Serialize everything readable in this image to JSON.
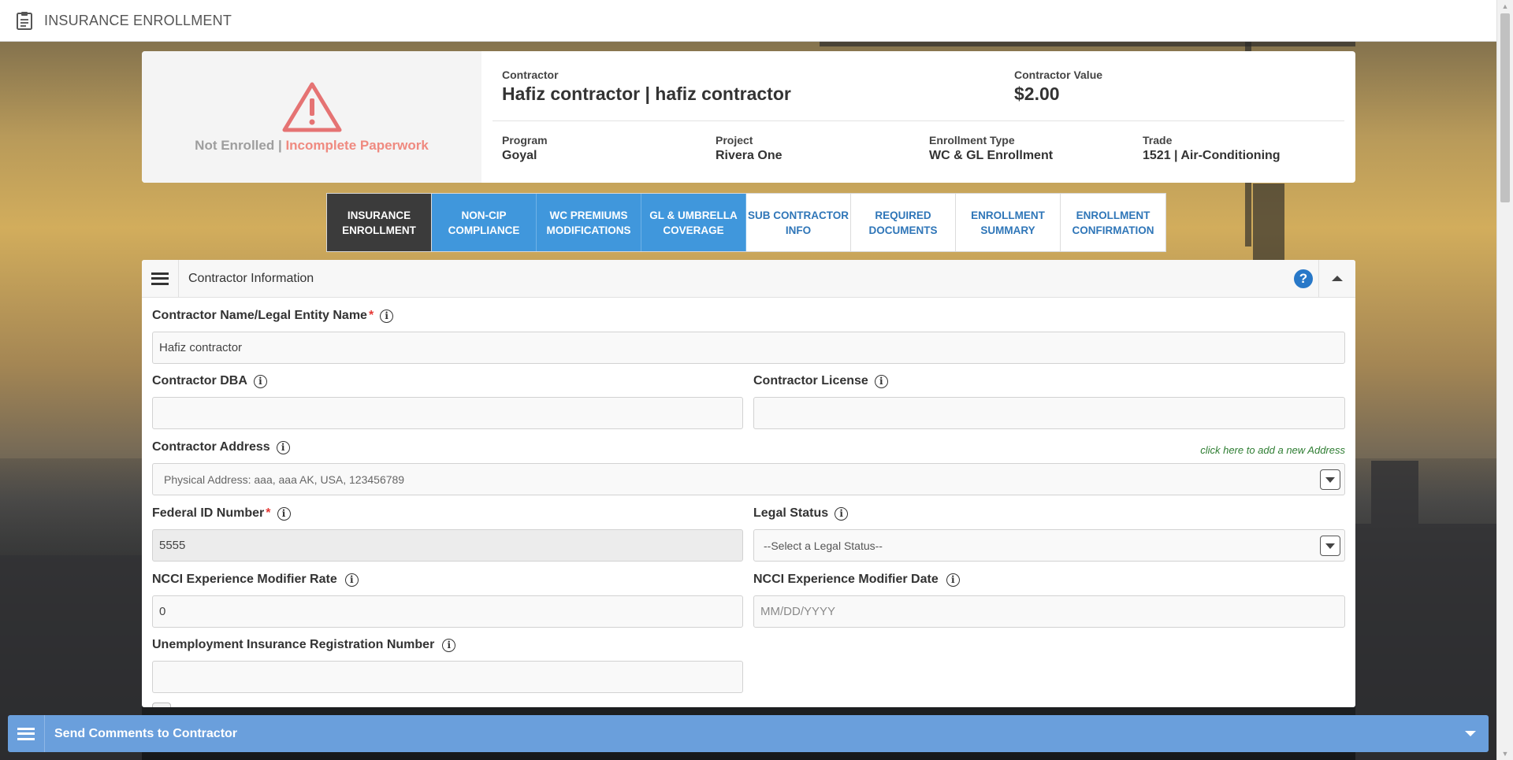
{
  "header": {
    "title": "INSURANCE ENROLLMENT",
    "icon": "clipboard-icon"
  },
  "summary": {
    "status_label": "Not Enrolled",
    "status_separator": " | ",
    "status_detail": "Incomplete Paperwork",
    "contractor_label": "Contractor",
    "contractor_value": "Hafiz contractor | hafiz contractor",
    "contractor_value_label": "Contractor Value",
    "contractor_value_amount": "$2.00",
    "program_label": "Program",
    "program_value": "Goyal",
    "project_label": "Project",
    "project_value": "Rivera One",
    "enrollment_type_label": "Enrollment Type",
    "enrollment_type_value": "WC & GL Enrollment",
    "trade_label": "Trade",
    "trade_value": "1521 | Air-Conditioning"
  },
  "tabs": [
    {
      "line1": "INSURANCE",
      "line2": "ENROLLMENT",
      "state": "active"
    },
    {
      "line1": "NON-CIP",
      "line2": "COMPLIANCE",
      "state": "done"
    },
    {
      "line1": "WC PREMIUMS",
      "line2": "MODIFICATIONS",
      "state": "done"
    },
    {
      "line1": "GL & UMBRELLA",
      "line2": "COVERAGE",
      "state": "done"
    },
    {
      "line1": "SUB CONTRACTOR",
      "line2": "INFO",
      "state": "pending"
    },
    {
      "line1": "REQUIRED",
      "line2": "DOCUMENTS",
      "state": "pending"
    },
    {
      "line1": "ENROLLMENT",
      "line2": "SUMMARY",
      "state": "pending"
    },
    {
      "line1": "ENROLLMENT",
      "line2": "CONFIRMATION",
      "state": "pending"
    }
  ],
  "panel": {
    "title": "Contractor Information",
    "help": "?",
    "fields": {
      "legal_name": {
        "label": "Contractor Name/Legal Entity Name",
        "value": "Hafiz contractor"
      },
      "dba": {
        "label": "Contractor DBA",
        "value": ""
      },
      "license": {
        "label": "Contractor License",
        "value": ""
      },
      "address": {
        "label": "Contractor Address",
        "value": "Physical Address: aaa, aaa AK, USA, 123456789",
        "add_link": "click here to add a new Address"
      },
      "federal_id": {
        "label": "Federal ID Number",
        "value": "5555"
      },
      "legal_status": {
        "label": "Legal Status",
        "value": "--Select a Legal Status--"
      },
      "emr_rate": {
        "label": "NCCI Experience Modifier Rate",
        "value": "0"
      },
      "emr_date": {
        "label": "NCCI Experience Modifier Date",
        "placeholder": "MM/DD/YYYY"
      },
      "unemployment": {
        "label": "Unemployment Insurance Registration Number",
        "value": ""
      }
    }
  },
  "comments": {
    "title": "Send Comments to Contractor"
  },
  "colors": {
    "active_tab": "#3b3b3b",
    "done_tab": "#4097dc",
    "pending_tab_text": "#2f76b8",
    "warning": "#e57373",
    "required": "#e53935",
    "comment_bar": "#6a9fdc",
    "help": "#2878c8"
  }
}
